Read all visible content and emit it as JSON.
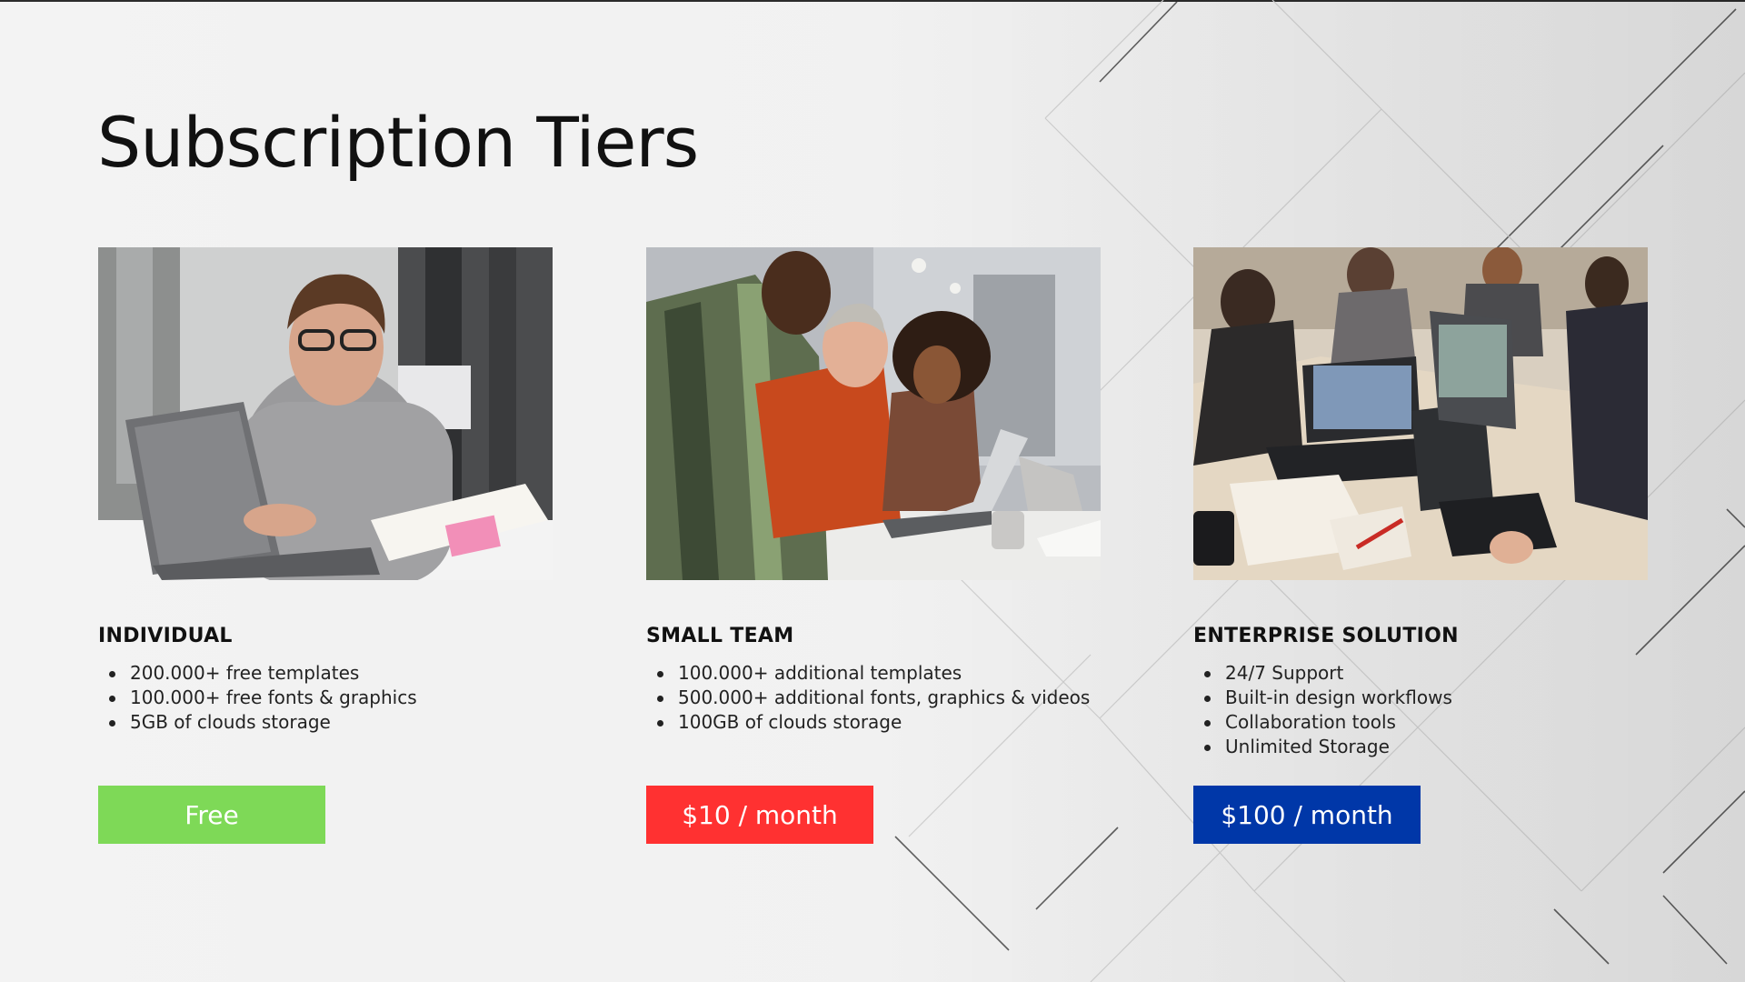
{
  "slide": {
    "title": "Subscription Tiers"
  },
  "tiers": [
    {
      "name": "INDIVIDUAL",
      "features": [
        "200.000+ free templates",
        "100.000+ free fonts & graphics",
        "5GB of clouds storage"
      ],
      "price_label": "Free",
      "button_color": "#7ed957",
      "image": "photo-man-with-laptop"
    },
    {
      "name": "SMALL TEAM",
      "features": [
        "100.000+ additional templates",
        "500.000+ additional fonts, graphics & videos",
        "100GB of clouds storage"
      ],
      "price_label": "$10 / month",
      "button_color": "#ff3131",
      "image": "photo-team-at-laptop"
    },
    {
      "name": "ENTERPRISE SOLUTION",
      "features": [
        "24/7 Support",
        "Built-in design workflows",
        "Collaboration tools",
        "Unlimited Storage"
      ],
      "price_label": "$100 / month",
      "button_color": "#0037a8",
      "image": "photo-group-with-laptops"
    }
  ]
}
